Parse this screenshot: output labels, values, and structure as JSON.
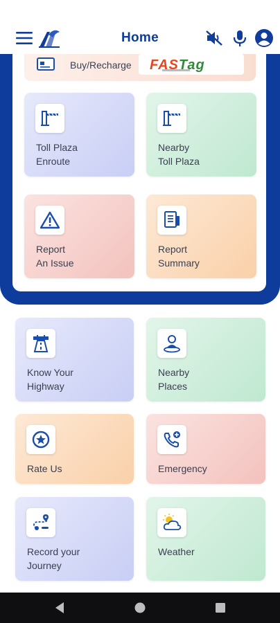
{
  "header": {
    "title": "Home",
    "menu_icon": "hamburger-menu-icon",
    "logo_icon": "nhai-logo-icon",
    "mute_icon": "volume-muted-icon",
    "mic_icon": "microphone-icon",
    "profile_icon": "account-circle-icon",
    "brand_color": "#0d3c9c"
  },
  "fastag": {
    "label": "Buy/Recharge",
    "logo_text_orange": "FAS",
    "logo_text_green": "Tag"
  },
  "panel_tiles": [
    {
      "label": "Toll Plaza\nEnroute",
      "icon": "toll-gate-icon"
    },
    {
      "label": "Nearby\nToll Plaza",
      "icon": "toll-gate-icon"
    },
    {
      "label": "Report\nAn Issue",
      "icon": "warning-triangle-icon"
    },
    {
      "label": "Report\nSummary",
      "icon": "report-document-icon"
    }
  ],
  "tiles": [
    {
      "label": "Know Your\nHighway",
      "icon": "highway-road-icon"
    },
    {
      "label": "Nearby\nPlaces",
      "icon": "location-person-icon"
    },
    {
      "label": "Rate Us",
      "icon": "star-badge-icon"
    },
    {
      "label": "Emergency",
      "icon": "phone-call-icon"
    },
    {
      "label": "Record your\nJourney",
      "icon": "route-path-icon"
    },
    {
      "label": "Weather",
      "icon": "sun-cloud-icon"
    }
  ]
}
